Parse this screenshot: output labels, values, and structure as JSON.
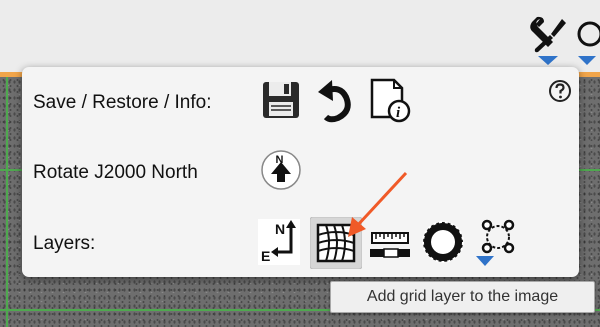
{
  "toolbar": {
    "tools_icon": "wrench-screwdriver-icon",
    "zoom_icon": "zoom-magnifier-icon",
    "accent_color": "#f1a54a"
  },
  "panel": {
    "rows": [
      {
        "label": "Save / Restore / Info:",
        "icons": [
          "save-floppy-icon",
          "restore-arrow-icon",
          "info-document-icon"
        ]
      },
      {
        "label": "Rotate J2000 North",
        "icons": [
          "rotate-north-icon"
        ]
      },
      {
        "label": "Layers:",
        "icons": [
          "compass-layer-icon",
          "grid-layer-icon",
          "ruler-layer-icon",
          "circle-layer-icon",
          "shape-layer-icon"
        ]
      }
    ],
    "help_icon": "help-question-icon"
  },
  "tooltip": {
    "text": "Add grid layer to the image"
  },
  "annotation": {
    "arrow_color": "#f05a28"
  }
}
